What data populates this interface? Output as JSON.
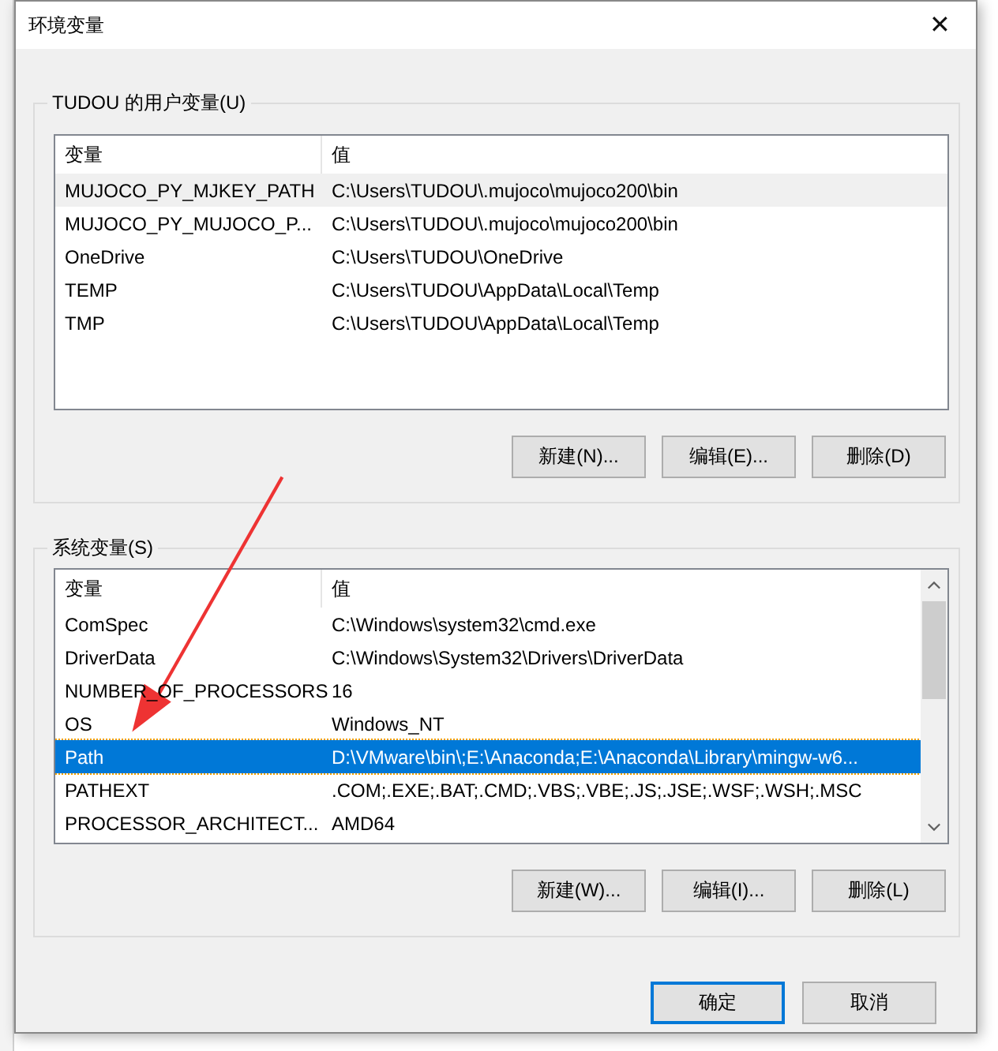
{
  "window": {
    "title": "环境变量",
    "close": "✕"
  },
  "user_vars": {
    "label": "TUDOU 的用户变量(U)",
    "focused": false,
    "columns": [
      "变量",
      "值"
    ],
    "rows": [
      {
        "name": "MUJOCO_PY_MJKEY_PATH",
        "value": "C:\\Users\\TUDOU\\.mujoco\\mujoco200\\bin",
        "selected": true
      },
      {
        "name": "MUJOCO_PY_MUJOCO_P...",
        "value": "C:\\Users\\TUDOU\\.mujoco\\mujoco200\\bin",
        "selected": false
      },
      {
        "name": "OneDrive",
        "value": "C:\\Users\\TUDOU\\OneDrive",
        "selected": false
      },
      {
        "name": "TEMP",
        "value": "C:\\Users\\TUDOU\\AppData\\Local\\Temp",
        "selected": false
      },
      {
        "name": "TMP",
        "value": "C:\\Users\\TUDOU\\AppData\\Local\\Temp",
        "selected": false
      }
    ],
    "buttons": [
      "新建(N)...",
      "编辑(E)...",
      "删除(D)"
    ]
  },
  "system_vars": {
    "label": "系统变量(S)",
    "focused": true,
    "columns": [
      "变量",
      "值"
    ],
    "rows": [
      {
        "name": "ComSpec",
        "value": "C:\\Windows\\system32\\cmd.exe",
        "selected": false
      },
      {
        "name": "DriverData",
        "value": "C:\\Windows\\System32\\Drivers\\DriverData",
        "selected": false
      },
      {
        "name": "NUMBER_OF_PROCESSORS",
        "value": "16",
        "selected": false
      },
      {
        "name": "OS",
        "value": "Windows_NT",
        "selected": false
      },
      {
        "name": "Path",
        "value": "D:\\VMware\\bin\\;E:\\Anaconda;E:\\Anaconda\\Library\\mingw-w6...",
        "selected": true
      },
      {
        "name": "PATHEXT",
        "value": ".COM;.EXE;.BAT;.CMD;.VBS;.VBE;.JS;.JSE;.WSF;.WSH;.MSC",
        "selected": false
      },
      {
        "name": "PROCESSOR_ARCHITECT...",
        "value": "AMD64",
        "selected": false
      }
    ],
    "buttons": [
      "新建(W)...",
      "编辑(I)...",
      "删除(L)"
    ]
  },
  "footer_buttons": [
    {
      "label": "确定",
      "default": true
    },
    {
      "label": "取消",
      "default": false
    }
  ]
}
